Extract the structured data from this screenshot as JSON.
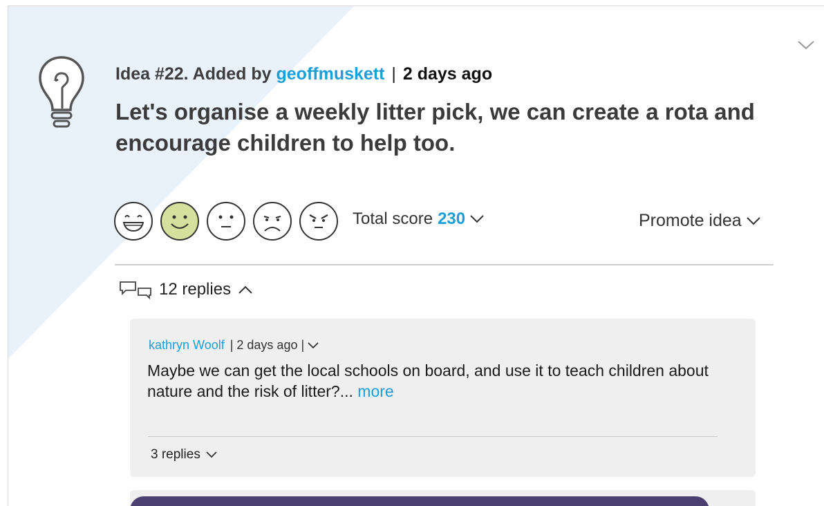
{
  "idea": {
    "prefix": "Idea #22. Added by",
    "author": "geoffmuskett",
    "separator": "|",
    "date": "2 days ago",
    "title": "Let's organise a weekly litter pick, we can create a rota and encourage children to help too."
  },
  "reactions": [
    {
      "name": "very-happy",
      "selected": false
    },
    {
      "name": "happy",
      "selected": true
    },
    {
      "name": "neutral",
      "selected": false
    },
    {
      "name": "sad",
      "selected": false
    },
    {
      "name": "angry",
      "selected": false
    }
  ],
  "score": {
    "label": "Total score",
    "value": "230"
  },
  "promote": {
    "label": "Promote idea"
  },
  "replies": {
    "label": "12 replies"
  },
  "reply": {
    "author": "kathryn Woolf",
    "meta": "| 2 days ago |",
    "body": "Maybe we can get the local schools on board, and use it to teach children about nature and the risk of litter?...",
    "more": "more",
    "sub_replies": "3 replies"
  },
  "colors": {
    "accent": "#1c9fd6",
    "selected_face": "#d4e09b",
    "background_tint": "#e9f1fb",
    "next_card_bar": "#4b3f72"
  }
}
